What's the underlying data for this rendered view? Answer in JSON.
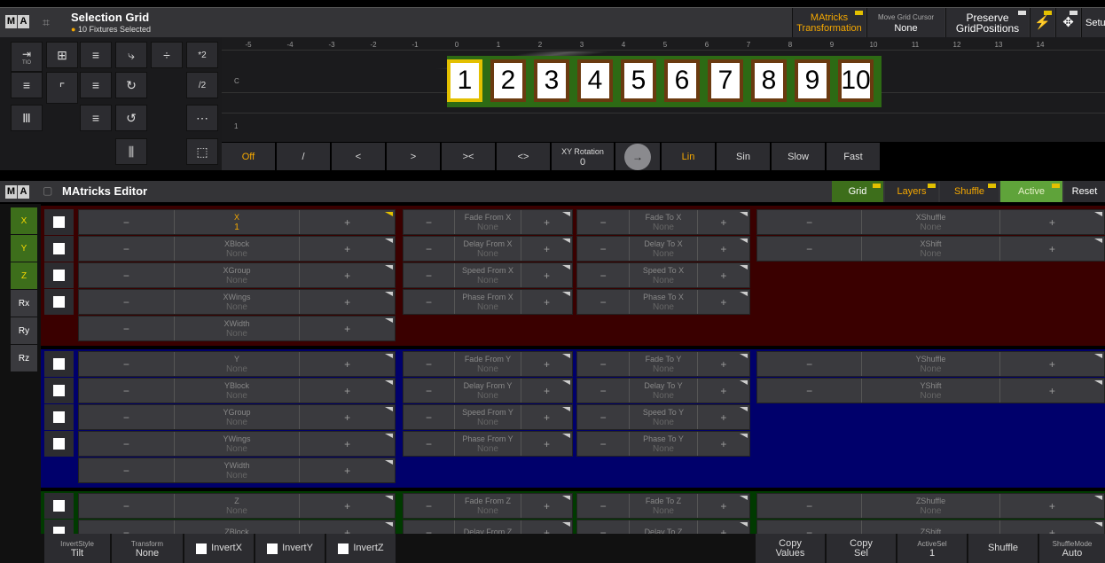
{
  "selection_grid": {
    "title": "Selection Grid",
    "subtitle": "10 Fixtures Selected",
    "header_buttons": {
      "matricks": "MAtricks",
      "transformation": "Transformation",
      "move_cursor_label": "Move Grid Cursor",
      "move_cursor_value": "None",
      "preserve": "Preserve",
      "grid_positions": "GridPositions",
      "setup": "Setup"
    },
    "tools": {
      "tilde": "TIO",
      "times2": "*2",
      "div2": "/2"
    },
    "ticks": [
      "-5",
      "-4",
      "-3",
      "-2",
      "-1",
      "0",
      "1",
      "2",
      "3",
      "4",
      "5",
      "6",
      "7",
      "8",
      "9",
      "10",
      "11",
      "12",
      "13",
      "14"
    ],
    "row_labels": [
      "C",
      "1"
    ],
    "fixtures": [
      "1",
      "2",
      "3",
      "4",
      "5",
      "6",
      "7",
      "8",
      "9",
      "10"
    ],
    "transform_bar": {
      "off": "Off",
      "slash": "/",
      "lt": "<",
      "gt": ">",
      "gtlt": "><",
      "ltgt": "<>",
      "xy_rotation_label": "XY Rotation",
      "xy_rotation_value": "0",
      "lin": "Lin",
      "sin": "Sin",
      "slow": "Slow",
      "fast": "Fast"
    }
  },
  "editor": {
    "title": "MAtricks Editor",
    "header_buttons": {
      "grid": "Grid",
      "layers": "Layers",
      "shuffle": "Shuffle",
      "active": "Active",
      "reset": "Reset"
    },
    "axes": [
      "X",
      "Y",
      "Z",
      "Rx",
      "Ry",
      "Rz"
    ],
    "x_block": {
      "left": [
        {
          "label": "X",
          "value": "1"
        },
        {
          "label": "XBlock",
          "value": "None"
        },
        {
          "label": "XGroup",
          "value": "None"
        },
        {
          "label": "XWings",
          "value": "None"
        },
        {
          "label": "XWidth",
          "value": "None"
        }
      ],
      "mid": [
        {
          "label": "Fade From X",
          "value": "None"
        },
        {
          "label": "Delay From X",
          "value": "None"
        },
        {
          "label": "Speed From X",
          "value": "None"
        },
        {
          "label": "Phase From X",
          "value": "None"
        }
      ],
      "mid2": [
        {
          "label": "Fade To X",
          "value": "None"
        },
        {
          "label": "Delay To X",
          "value": "None"
        },
        {
          "label": "Speed To X",
          "value": "None"
        },
        {
          "label": "Phase To X",
          "value": "None"
        }
      ],
      "right": [
        {
          "label": "XShuffle",
          "value": "None"
        },
        {
          "label": "XShift",
          "value": "None"
        }
      ]
    },
    "y_block": {
      "left": [
        {
          "label": "Y",
          "value": "None"
        },
        {
          "label": "YBlock",
          "value": "None"
        },
        {
          "label": "YGroup",
          "value": "None"
        },
        {
          "label": "YWings",
          "value": "None"
        },
        {
          "label": "YWidth",
          "value": "None"
        }
      ],
      "mid": [
        {
          "label": "Fade From Y",
          "value": "None"
        },
        {
          "label": "Delay From Y",
          "value": "None"
        },
        {
          "label": "Speed From Y",
          "value": "None"
        },
        {
          "label": "Phase From Y",
          "value": "None"
        }
      ],
      "mid2": [
        {
          "label": "Fade To Y",
          "value": "None"
        },
        {
          "label": "Delay To Y",
          "value": "None"
        },
        {
          "label": "Speed To Y",
          "value": "None"
        },
        {
          "label": "Phase To Y",
          "value": "None"
        }
      ],
      "right": [
        {
          "label": "YShuffle",
          "value": "None"
        },
        {
          "label": "YShift",
          "value": "None"
        }
      ]
    },
    "z_block": {
      "left": [
        {
          "label": "Z",
          "value": "None"
        },
        {
          "label": "ZBlock",
          "value": ""
        }
      ],
      "mid": [
        {
          "label": "Fade From Z",
          "value": "None"
        },
        {
          "label": "Delay From Z",
          "value": ""
        }
      ],
      "mid2": [
        {
          "label": "Fade To Z",
          "value": "None"
        },
        {
          "label": "Delay To Z",
          "value": ""
        }
      ],
      "right": [
        {
          "label": "ZShuffle",
          "value": "None"
        },
        {
          "label": "ZShift",
          "value": ""
        }
      ]
    },
    "minus": "−",
    "plus": "+",
    "bottom": {
      "invert_style_label": "InvertStyle",
      "invert_style_value": "Tilt",
      "transform_label": "Transform",
      "transform_value": "None",
      "invert_x": "InvertX",
      "invert_y": "InvertY",
      "invert_z": "InvertZ",
      "copy_values_1": "Copy",
      "copy_values_2": "Values",
      "copy_sel_1": "Copy",
      "copy_sel_2": "Sel",
      "active_sel_label": "ActiveSel",
      "active_sel_value": "1",
      "shuffle": "Shuffle",
      "shuffle_mode_label": "ShuffleMode",
      "shuffle_mode_value": "Auto"
    }
  },
  "colors": {
    "accent_orange": "#f5a800",
    "x_bg": "#3a0000",
    "y_bg": "#00006b",
    "z_bg": "#003a00",
    "grid_green": "#3d6e1b"
  }
}
